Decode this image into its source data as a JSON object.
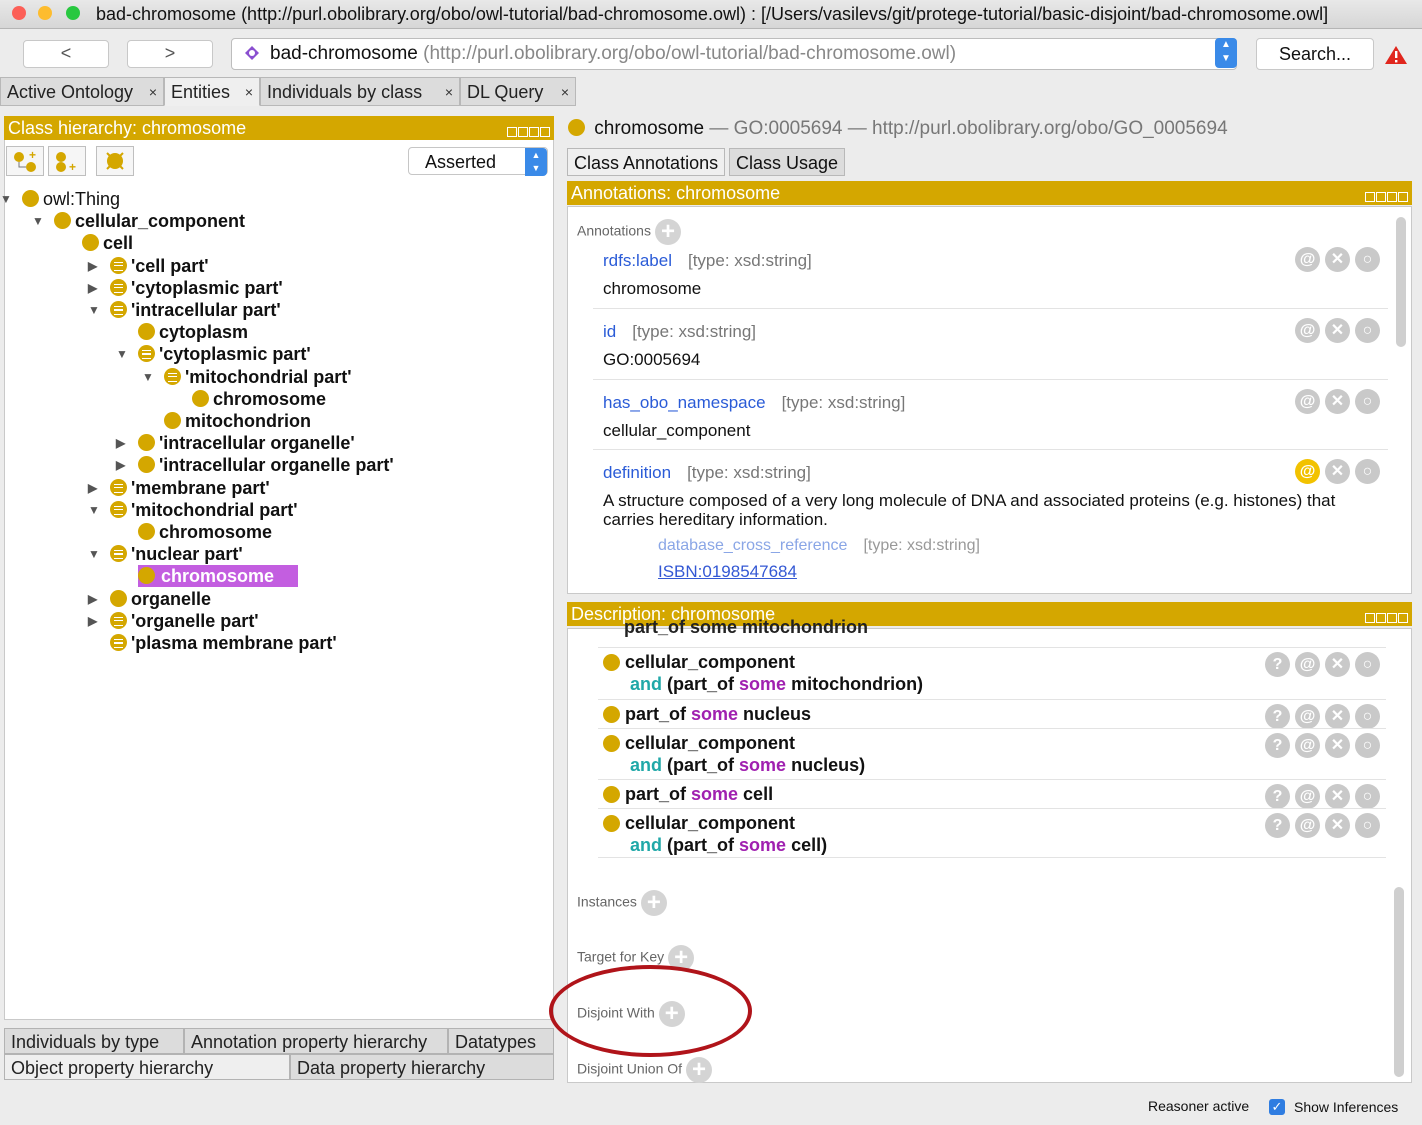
{
  "window": {
    "title": "bad-chromosome (http://purl.obolibrary.org/obo/owl-tutorial/bad-chromosome.owl)  : [/Users/vasilevs/git/protege-tutorial/basic-disjoint/bad-chromosome.owl]"
  },
  "toolbar": {
    "back": "<",
    "forward": ">",
    "ontology_name": "bad-chromosome",
    "ontology_url": "(http://purl.obolibrary.org/obo/owl-tutorial/bad-chromosome.owl)",
    "search": "Search..."
  },
  "tabs": [
    {
      "label": "Active Ontology",
      "close": "×"
    },
    {
      "label": "Entities",
      "close": "×"
    },
    {
      "label": "Individuals by class",
      "close": "×"
    },
    {
      "label": "DL Query",
      "close": "×"
    }
  ],
  "left": {
    "header": "Class hierarchy: chromosome",
    "mode": "Asserted",
    "tree": [
      {
        "label": "owl:Thing",
        "toggle": "▼",
        "kind": "class"
      },
      {
        "label": "cellular_component",
        "toggle": "▼",
        "kind": "class"
      },
      {
        "label": "cell",
        "toggle": "",
        "kind": "class"
      },
      {
        "label": "'cell part'",
        "toggle": "▶",
        "kind": "defined"
      },
      {
        "label": "'cytoplasmic part'",
        "toggle": "▶",
        "kind": "defined"
      },
      {
        "label": "'intracellular part'",
        "toggle": "▼",
        "kind": "defined"
      },
      {
        "label": "cytoplasm",
        "toggle": "",
        "kind": "class"
      },
      {
        "label": "'cytoplasmic part'",
        "toggle": "▼",
        "kind": "defined"
      },
      {
        "label": "'mitochondrial part'",
        "toggle": "▼",
        "kind": "defined"
      },
      {
        "label": "chromosome",
        "toggle": "",
        "kind": "class"
      },
      {
        "label": "mitochondrion",
        "toggle": "",
        "kind": "class"
      },
      {
        "label": "'intracellular organelle'",
        "toggle": "▶",
        "kind": "class"
      },
      {
        "label": "'intracellular organelle part'",
        "toggle": "▶",
        "kind": "class"
      },
      {
        "label": "'membrane part'",
        "toggle": "▶",
        "kind": "defined"
      },
      {
        "label": "'mitochondrial part'",
        "toggle": "▼",
        "kind": "defined"
      },
      {
        "label": "chromosome",
        "toggle": "",
        "kind": "class"
      },
      {
        "label": "'nuclear part'",
        "toggle": "▼",
        "kind": "defined"
      },
      {
        "label": "chromosome",
        "toggle": "",
        "kind": "class",
        "selected": true
      },
      {
        "label": "organelle",
        "toggle": "▶",
        "kind": "class"
      },
      {
        "label": "'organelle part'",
        "toggle": "▶",
        "kind": "defined"
      },
      {
        "label": "'plasma membrane part'",
        "toggle": "",
        "kind": "defined"
      }
    ],
    "bottom_tabs_row1": [
      "Individuals by type",
      "Annotation property hierarchy",
      "Datatypes"
    ],
    "bottom_tabs_row2": [
      "Object property hierarchy",
      "Data property hierarchy"
    ]
  },
  "right": {
    "entity": "chromosome",
    "entity_meta": "— GO:0005694 — http://purl.obolibrary.org/obo/GO_0005694",
    "tabs": [
      "Class Annotations",
      "Class Usage"
    ],
    "ann_header": "Annotations: chromosome",
    "ann_section": "Annotations",
    "annotations": [
      {
        "prop": "rdfs:label",
        "type": "[type: xsd:string]",
        "value": "chromosome"
      },
      {
        "prop": "id",
        "type": "[type: xsd:string]",
        "value": "GO:0005694"
      },
      {
        "prop": "has_obo_namespace",
        "type": "[type: xsd:string]",
        "value": "cellular_component"
      },
      {
        "prop": "definition",
        "type": "[type: xsd:string]",
        "value": "A structure composed of a very long molecule of DNA and associated proteins (e.g. histones) that carries hereditary information."
      }
    ],
    "sub_annotation": {
      "prop": "database_cross_reference",
      "type": "[type: xsd:string]",
      "value": "ISBN:0198547684"
    },
    "desc_header": "Description: chromosome",
    "desc_items": [
      {
        "line1": "cellular_component",
        "and": "and",
        "line2a": "(part_of ",
        "some": "some",
        "line2b": " mitochondrion)"
      },
      {
        "pre": "part_of ",
        "some": "some",
        "post": " nucleus"
      },
      {
        "line1": "cellular_component",
        "and": "and",
        "line2a": "(part_of ",
        "some": "some",
        "line2b": " nucleus)"
      },
      {
        "pre": "part_of ",
        "some": "some",
        "post": " cell"
      },
      {
        "line1": "cellular_component",
        "and": "and",
        "line2a": "(part_of ",
        "some": "some",
        "line2b": " cell)"
      }
    ],
    "desc_partial": "part_of some mitochondrion",
    "sections": [
      "Instances",
      "Target for Key",
      "Disjoint With",
      "Disjoint Union Of"
    ]
  },
  "status": {
    "reasoner": "Reasoner active",
    "show_inferences": "Show Inferences"
  },
  "colors": {
    "accent": "#d4a700",
    "selection": "#c35ee0",
    "highlight_oval": "#b0141a"
  }
}
